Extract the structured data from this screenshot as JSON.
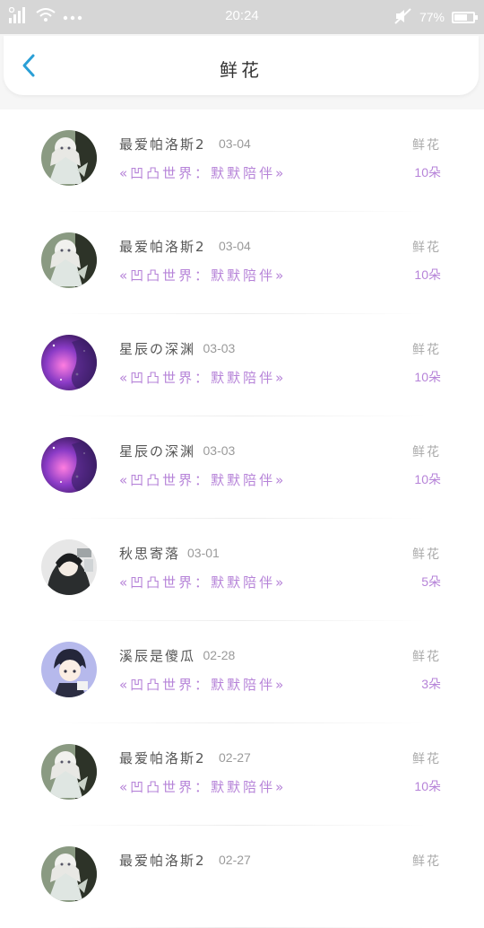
{
  "status_bar": {
    "time": "20:24",
    "battery_percent": "77%",
    "battery_level": 0.77
  },
  "header": {
    "title": "鲜花"
  },
  "records": [
    {
      "user": "最爱帕洛斯2",
      "date": "03-04",
      "world": "«凹凸世界：默默陪伴»",
      "type": "鲜花",
      "count": "10朵",
      "avatar": "white-hair-girl"
    },
    {
      "user": "最爱帕洛斯2",
      "date": "03-04",
      "world": "«凹凸世界：默默陪伴»",
      "type": "鲜花",
      "count": "10朵",
      "avatar": "white-hair-girl"
    },
    {
      "user": "星辰の深渊",
      "date": "03-03",
      "world": "«凹凸世界：默默陪伴»",
      "type": "鲜花",
      "count": "10朵",
      "avatar": "purple-galaxy"
    },
    {
      "user": "星辰の深渊",
      "date": "03-03",
      "world": "«凹凸世界：默默陪伴»",
      "type": "鲜花",
      "count": "10朵",
      "avatar": "purple-galaxy"
    },
    {
      "user": "秋思寄落",
      "date": "03-01",
      "world": "«凹凸世界：默默陪伴»",
      "type": "鲜花",
      "count": "5朵",
      "avatar": "dark-hair-character"
    },
    {
      "user": "溪辰是傻瓜",
      "date": "02-28",
      "world": "«凹凸世界：默默陪伴»",
      "type": "鲜花",
      "count": "3朵",
      "avatar": "chibi-boy"
    },
    {
      "user": "最爱帕洛斯2",
      "date": "02-27",
      "world": "«凹凸世界：默默陪伴»",
      "type": "鲜花",
      "count": "10朵",
      "avatar": "white-hair-girl"
    },
    {
      "user": "最爱帕洛斯2",
      "date": "02-27",
      "world": "",
      "type": "鲜花",
      "count": "",
      "avatar": "white-hair-girl"
    }
  ],
  "colors": {
    "accent_blue": "#2a9fd6",
    "purple_text": "#b683d8",
    "status_bar_bg": "#d6d6d6"
  }
}
